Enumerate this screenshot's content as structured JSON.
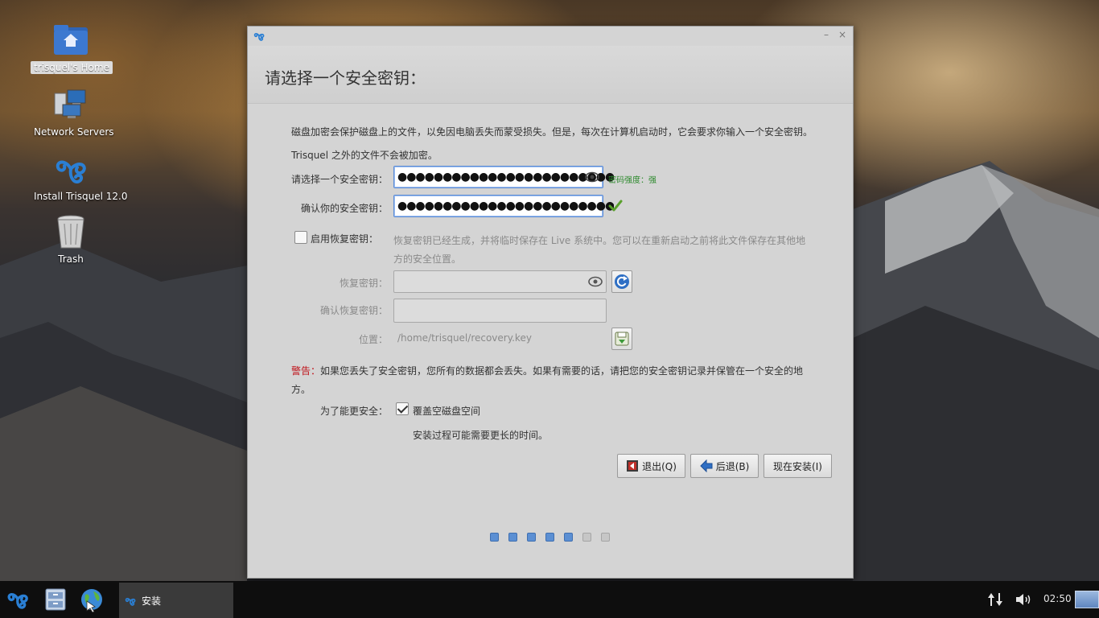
{
  "desktop": {
    "icons": [
      {
        "label": "trisquel's Home"
      },
      {
        "label": "Network Servers"
      },
      {
        "label": "Install Trisquel 12.0"
      },
      {
        "label": "Trash"
      }
    ]
  },
  "window": {
    "title_controls": {
      "minimize": "–",
      "close": "×"
    },
    "page_title": "请选择一个安全密钥：",
    "intro_line1": "磁盘加密会保护磁盘上的文件，以免因电脑丢失而蒙受损失。但是，每次在计算机启动时，它会要求你输入一个安全密钥。",
    "intro_line2": "Trisquel 之外的文件不会被加密。",
    "key_label": "请选择一个安全密钥：",
    "key_value": "●●●●●●●●●●●●●●●●●●●●●●●●",
    "strength": "密码强度：强",
    "confirm_label": "确认你的安全密钥：",
    "confirm_value": "●●●●●●●●●●●●●●●●●●●●●●●●",
    "recovery_check_label": "启用恢复密钥：",
    "recovery_desc1": "恢复密钥已经生成，并将临时保存在 Live 系统中。您可以在重新启动之前将此文件保存在其他地",
    "recovery_desc2": "方的安全位置。",
    "recovery_key_label": "恢复密钥：",
    "recovery_confirm_label": "确认恢复密钥：",
    "location_label": "位置：",
    "location_value": "/home/trisquel/recovery.key",
    "warning_prefix": "警告：",
    "warning_line1": "如果您丢失了安全密钥，您所有的数据都会丢失。如果有需要的话，请把您的安全密钥记录并保管在一个安全的地",
    "warning_line2": "方。",
    "security_label": "为了能更安全：",
    "overwrite_label": "覆盖空磁盘空间",
    "overwrite_checked": true,
    "overwrite_note": "安装过程可能需要更长的时间。",
    "buttons": {
      "quit": "退出(Q)",
      "back": "后退(B)",
      "install": "现在安装(I)"
    },
    "steps_total": 7,
    "steps_done": 5,
    "warning_color": "#c0141b"
  },
  "taskbar": {
    "task_label": "安装",
    "clock": "02:50"
  }
}
